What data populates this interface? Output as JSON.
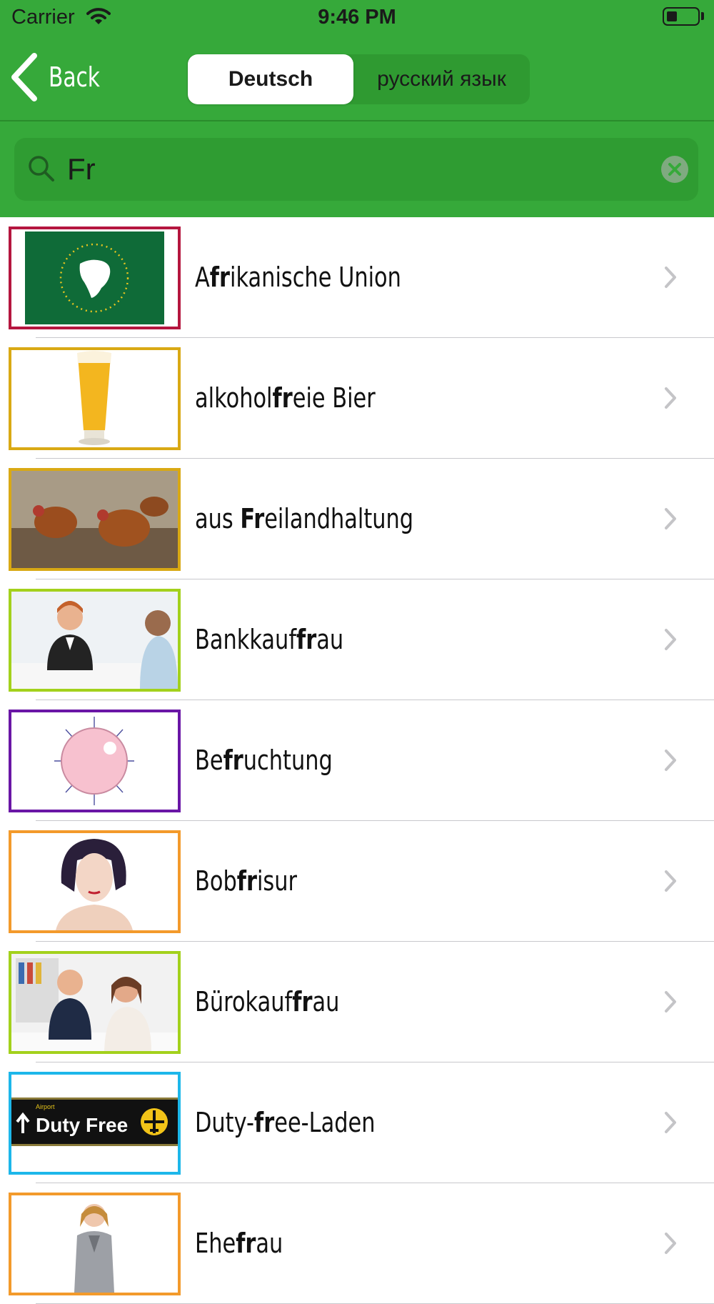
{
  "status_bar": {
    "carrier": "Carrier",
    "time": "9:46 PM"
  },
  "nav": {
    "back_label": "Back",
    "segments": [
      "Deutsch",
      "русский язык"
    ],
    "selected_segment": "Deutsch"
  },
  "search": {
    "value": "Fr",
    "highlight": "fr"
  },
  "items": [
    {
      "label": "Afrikanische Union",
      "image": "african-union-flag",
      "border_color": "#b5163f"
    },
    {
      "label": "alkoholfreie Bier",
      "image": "beer-glass",
      "border_color": "#d9a914"
    },
    {
      "label": "aus Freilandhaltung",
      "image": "free-range-chickens",
      "border_color": "#d9a914"
    },
    {
      "label": "Bankkauffrau",
      "image": "bank-clerk",
      "border_color": "#a3d11c"
    },
    {
      "label": "Befruchtung",
      "image": "egg-cell",
      "border_color": "#6a16a6"
    },
    {
      "label": "Bobfrisur",
      "image": "bob-haircut-woman",
      "border_color": "#f39a2b"
    },
    {
      "label": "Bürokauffrau",
      "image": "office-clerk",
      "border_color": "#a3d11c"
    },
    {
      "label": "Duty-free-Laden",
      "image": "duty-free-sign",
      "border_color": "#1db7ea"
    },
    {
      "label": "Ehefrau",
      "image": "wife",
      "border_color": "#f39a2b"
    }
  ]
}
